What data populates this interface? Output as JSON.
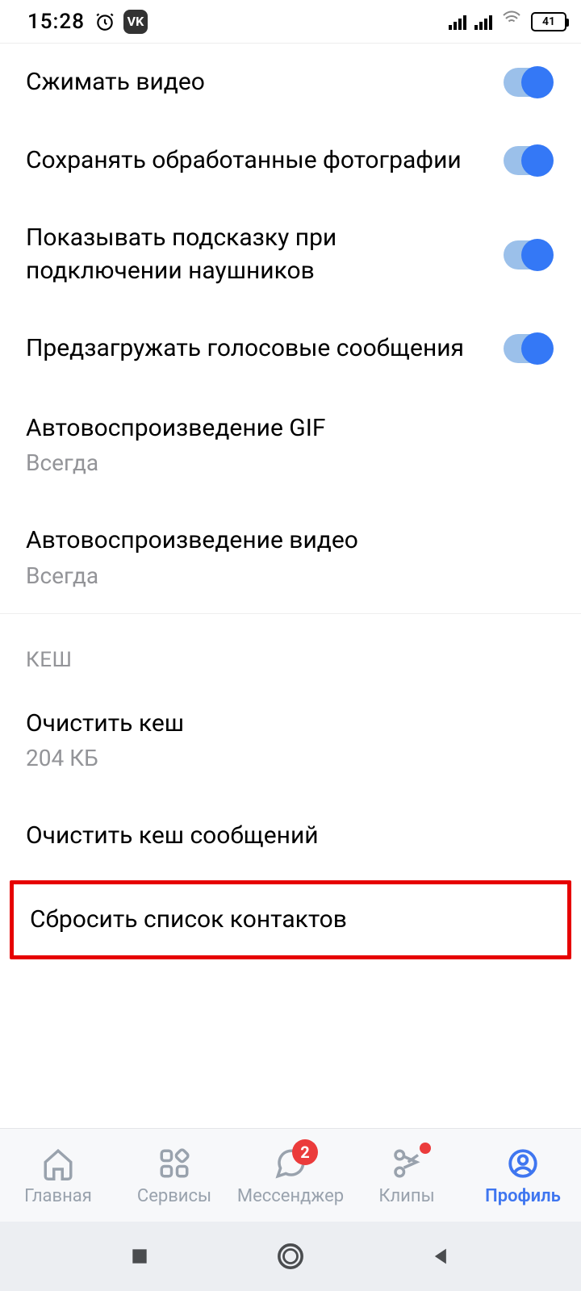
{
  "statusbar": {
    "time": "15:28",
    "battery": "41"
  },
  "settings": [
    {
      "title": "Сжимать видео",
      "toggle": true
    },
    {
      "title": "Сохранять обработанные фотографии",
      "toggle": true
    },
    {
      "title": "Показывать подсказку при подключении наушников",
      "toggle": true
    },
    {
      "title": "Предзагружать голосовые сообщения",
      "toggle": true
    },
    {
      "title": "Автовоспроизведение GIF",
      "subtitle": "Всегда"
    },
    {
      "title": "Автовоспроизведение видео",
      "subtitle": "Всегда"
    }
  ],
  "cache_section": {
    "header": "КЕШ",
    "items": [
      {
        "title": "Очистить кеш",
        "subtitle": "204 КБ"
      },
      {
        "title": "Очистить кеш сообщений"
      },
      {
        "title": "Сбросить список контактов",
        "highlighted": true
      }
    ]
  },
  "nav": {
    "home": "Главная",
    "services": "Сервисы",
    "messenger": "Мессенджер",
    "messenger_badge": "2",
    "clips": "Клипы",
    "profile": "Профиль"
  }
}
